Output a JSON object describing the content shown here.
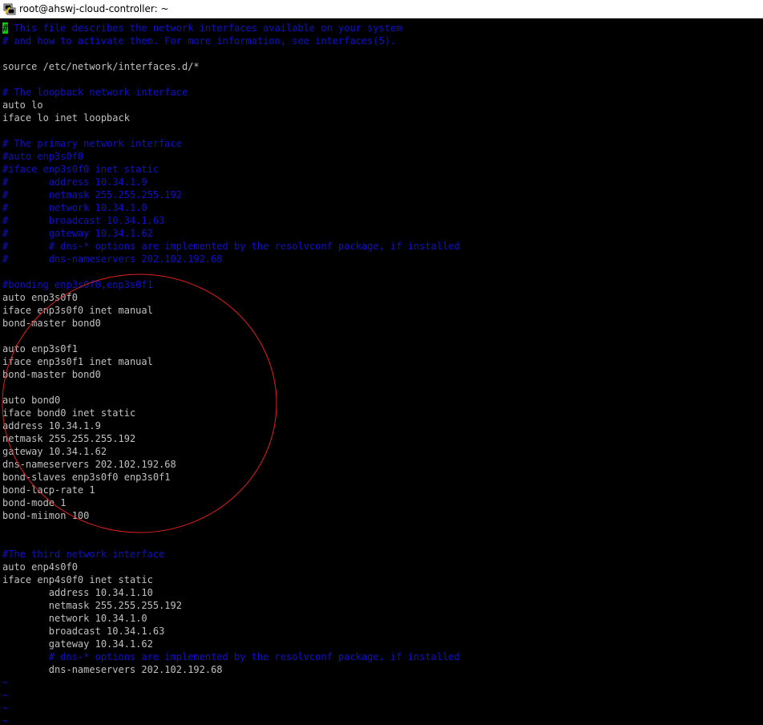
{
  "window": {
    "title": "root@ahswj-cloud-controller: ~"
  },
  "icons": {
    "app": "putty-terminal-icon"
  },
  "colors": {
    "background": "#000000",
    "text": "#c0c0c0",
    "comment": "#1010c8",
    "cursor": "#00d000",
    "annotation": "#e02020"
  },
  "editor": {
    "cursor_char": "#",
    "lines": [
      {
        "text": " This file describes the network interfaces available on your system",
        "type": "comment",
        "cursor": true
      },
      {
        "text": "# and how to activate them. For more information, see interfaces(5).",
        "type": "comment"
      },
      {
        "text": "",
        "type": "plain"
      },
      {
        "text": "source /etc/network/interfaces.d/*",
        "type": "plain"
      },
      {
        "text": "",
        "type": "plain"
      },
      {
        "text": "# The loopback network interface",
        "type": "comment"
      },
      {
        "text": "auto lo",
        "type": "plain"
      },
      {
        "text": "iface lo inet loopback",
        "type": "plain"
      },
      {
        "text": "",
        "type": "plain"
      },
      {
        "text": "# The primary network interface",
        "type": "comment"
      },
      {
        "text": "#auto enp3s0f0",
        "type": "comment"
      },
      {
        "text": "#iface enp3s0f0 inet static",
        "type": "comment"
      },
      {
        "text": "#       address 10.34.1.9",
        "type": "comment"
      },
      {
        "text": "#       netmask 255.255.255.192",
        "type": "comment"
      },
      {
        "text": "#       network 10.34.1.0",
        "type": "comment"
      },
      {
        "text": "#       broadcast 10.34.1.63",
        "type": "comment"
      },
      {
        "text": "#       gateway 10.34.1.62",
        "type": "comment"
      },
      {
        "text": "#       # dns-* options are implemented by the resolvconf package, if installed",
        "type": "comment"
      },
      {
        "text": "#       dns-nameservers 202.102.192.68",
        "type": "comment"
      },
      {
        "text": "",
        "type": "plain"
      },
      {
        "text": "#bonding enp3s0f0,enp3s0f1",
        "type": "comment"
      },
      {
        "text": "auto enp3s0f0",
        "type": "plain"
      },
      {
        "text": "iface enp3s0f0 inet manual",
        "type": "plain"
      },
      {
        "text": "bond-master bond0",
        "type": "plain"
      },
      {
        "text": "",
        "type": "plain"
      },
      {
        "text": "auto enp3s0f1",
        "type": "plain"
      },
      {
        "text": "iface enp3s0f1 inet manual",
        "type": "plain"
      },
      {
        "text": "bond-master bond0",
        "type": "plain"
      },
      {
        "text": "",
        "type": "plain"
      },
      {
        "text": "auto bond0",
        "type": "plain"
      },
      {
        "text": "iface bond0 inet static",
        "type": "plain"
      },
      {
        "text": "address 10.34.1.9",
        "type": "plain"
      },
      {
        "text": "netmask 255.255.255.192",
        "type": "plain"
      },
      {
        "text": "gateway 10.34.1.62",
        "type": "plain"
      },
      {
        "text": "dns-nameservers 202.102.192.68",
        "type": "plain"
      },
      {
        "text": "bond-slaves enp3s0f0 enp3s0f1",
        "type": "plain"
      },
      {
        "text": "bond-lacp-rate 1",
        "type": "plain"
      },
      {
        "text": "bond-mode 1",
        "type": "plain"
      },
      {
        "text": "bond-miimon 100",
        "type": "plain"
      },
      {
        "text": "",
        "type": "plain"
      },
      {
        "text": "",
        "type": "plain"
      },
      {
        "text": "#The third network interface",
        "type": "comment"
      },
      {
        "text": "auto enp4s0f0",
        "type": "plain"
      },
      {
        "text": "iface enp4s0f0 inet static",
        "type": "plain"
      },
      {
        "text": "        address 10.34.1.10",
        "type": "plain"
      },
      {
        "text": "        netmask 255.255.255.192",
        "type": "plain"
      },
      {
        "text": "        network 10.34.1.0",
        "type": "plain"
      },
      {
        "text": "        broadcast 10.34.1.63",
        "type": "plain"
      },
      {
        "text": "        gateway 10.34.1.62",
        "type": "plain"
      },
      {
        "text": "        # dns-* options are implemented by the resolvconf package, if installed",
        "type": "comment"
      },
      {
        "text": "        dns-nameservers 202.102.192.68",
        "type": "plain"
      },
      {
        "text": "~",
        "type": "tilde"
      },
      {
        "text": "~",
        "type": "tilde"
      },
      {
        "text": "~",
        "type": "tilde"
      },
      {
        "text": "~",
        "type": "tilde"
      }
    ]
  }
}
